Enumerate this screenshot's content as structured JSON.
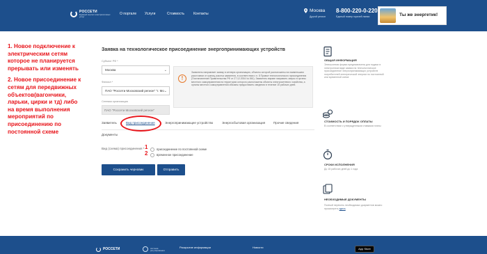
{
  "header": {
    "logo_name": "РОССЕТИ",
    "logo_sub": "Единый портал электросетевых услуг",
    "nav": [
      "О портале",
      "Услуги",
      "Стоимость",
      "Контакты"
    ],
    "city": "Москва",
    "city_sub": "Другой регион",
    "phone": "8-800-220-0-220",
    "phone_sub": "Единый номер горячей линии",
    "banner_text": "Ты же энергетик!"
  },
  "annotation": {
    "item1": "1. Новое подключение к электрическим сетям которое не планируется прерывать или изменять",
    "item2": "2. Новое присоединение к сетям для передвижных объектов(вагончики, ларьки, цирки и тд) либо на время выполнения мероприятий по присоединению по постоянной схеме"
  },
  "form": {
    "title": "Заявка на технологическое присоединение энергопринимающих устройств",
    "subject_label": "Субъект РФ *",
    "subject_value": "Москва",
    "branch_label": "Филиал *",
    "branch_value": "ПАО \"Россети Московский регион\" \"г. Мос",
    "grid_org_label": "Сетевая организация",
    "grid_org_value": "ПАО \"Россети Московский регион\"",
    "warning_text": "Заявитель направляет заявку в сетевую организацию, объекты которой расположены на наименьшем расстоянии от границ участка заявителя, в соответствии с п. 8 Правил технологического присоединения (Постановление Правительства РФ от 27.12.2004 № 861). Заявитель вправе направить запрос в органы местного самоуправления на территории которого расположены объекты электросетевого хозяйства, а органы местного самоуправления обязаны предоставить сведения в течение 15 рабочих дней.",
    "tabs": [
      "Заявитель",
      "Вид присоединения",
      "Энергопринимающее устройство",
      "Энергосбытовая организация",
      "Прочие сведения"
    ],
    "docs_tab": "Документы",
    "question_label": "Вид (схема) присоединения *",
    "num1": "1",
    "num2": "2",
    "option1": "присоединение по постоянной схеме",
    "option2": "временное присоединение",
    "save_draft": "Сохранить черновик",
    "submit": "Отправить"
  },
  "sidebar": [
    {
      "icon": "document-icon",
      "title": "ОБЩАЯ ИНФОРМАЦИЯ",
      "text": "Электронная форма предназначена для подачи в электронном виде заявки на технологическое присоединение энергопринимающих устройств потребителей электрической энергии по постоянной или временной схеме"
    },
    {
      "icon": "coins-icon",
      "title": "СТОИМОСТЬ И ПОРЯДОК ОПЛАТЫ",
      "text": "В соответствии с утвержденными ставками платы"
    },
    {
      "icon": "stopwatch-icon",
      "title": "СРОКИ ИСПОЛНЕНИЯ",
      "text": "До 15 рабочих дней до 1 года"
    },
    {
      "icon": "files-icon",
      "title": "НЕОБХОДИМЫЕ ДОКУМЕНТЫ",
      "text": "Полный перечень необходимых документов можно просмотреть",
      "link": "здесь"
    }
  ],
  "footer": {
    "logo_name": "РОССЕТИ",
    "logo2": "система регулирования",
    "links": [
      "Раскрытие информации",
      "Новости"
    ],
    "appstore": "App Store"
  },
  "colors": {
    "brand": "#1d4f8c",
    "annotation": "#e8151b",
    "warning": "#e6792b"
  }
}
